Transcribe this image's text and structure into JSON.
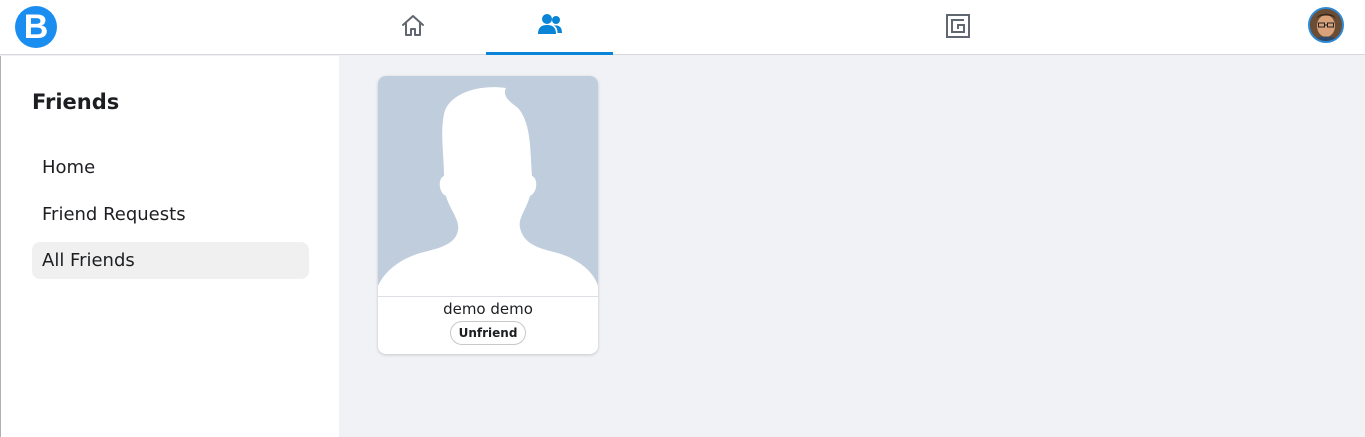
{
  "header": {
    "logo_letter": "B",
    "tabs": [
      {
        "name": "home",
        "icon": "home-icon",
        "active": false
      },
      {
        "name": "friends",
        "icon": "friends-icon",
        "active": true
      },
      {
        "name": "groups",
        "icon": "groups-icon",
        "active": false
      }
    ],
    "accent_color": "#0a84d6"
  },
  "sidebar": {
    "title": "Friends",
    "items": [
      {
        "label": "Home",
        "active": false
      },
      {
        "label": "Friend Requests",
        "active": false
      },
      {
        "label": "All Friends",
        "active": true
      }
    ]
  },
  "friends": [
    {
      "name": "demo demo",
      "action_label": "Unfriend"
    }
  ]
}
